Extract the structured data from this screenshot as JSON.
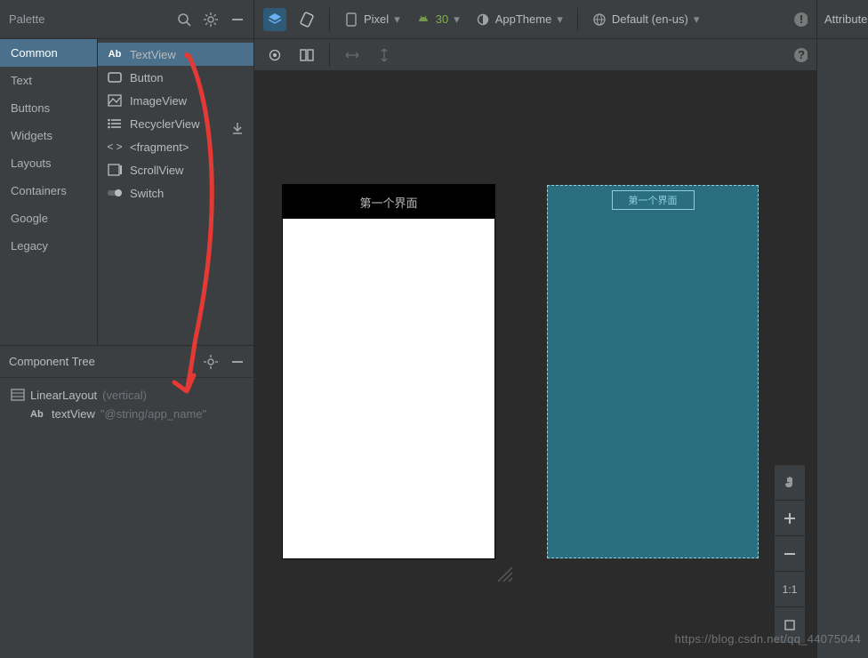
{
  "palette": {
    "title": "Palette",
    "categories": [
      "Common",
      "Text",
      "Buttons",
      "Widgets",
      "Layouts",
      "Containers",
      "Google",
      "Legacy"
    ],
    "widgets": [
      {
        "icon": "Ab",
        "label": "TextView"
      },
      {
        "icon": "btn",
        "label": "Button"
      },
      {
        "icon": "img",
        "label": "ImageView"
      },
      {
        "icon": "list",
        "label": "RecyclerView"
      },
      {
        "icon": "frag",
        "label": "<fragment>"
      },
      {
        "icon": "scroll",
        "label": "ScrollView"
      },
      {
        "icon": "switch",
        "label": "Switch"
      }
    ]
  },
  "componentTree": {
    "title": "Component Tree",
    "root": {
      "label": "LinearLayout",
      "modifier": "(vertical)"
    },
    "child": {
      "icon": "Ab",
      "label": "textView",
      "attr": "\"@string/app_name\""
    }
  },
  "toolbar": {
    "device": "Pixel",
    "api": "30",
    "theme": "AppTheme",
    "locale": "Default (en-us)"
  },
  "preview": {
    "title_cn": "第一个界面",
    "blueprint_label": "第一个界面"
  },
  "zoom": {
    "one_to_one": "1:1"
  },
  "attr": {
    "title": "Attribute"
  },
  "watermark": "https://blog.csdn.net/qq_44075044"
}
